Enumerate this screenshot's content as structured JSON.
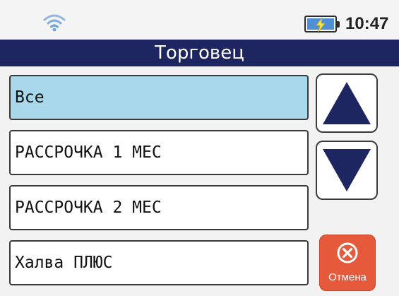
{
  "status": {
    "time": "10:47",
    "wifi_icon": "wifi-icon",
    "battery_icon": "battery-charging-icon"
  },
  "header": {
    "title": "Торговец"
  },
  "list": {
    "items": [
      {
        "label": "Все",
        "selected": true
      },
      {
        "label": "РАССРОЧКА 1 МЕС",
        "selected": false
      },
      {
        "label": "РАССРОЧКА 2 МЕС",
        "selected": false
      },
      {
        "label": "Халва ПЛЮС",
        "selected": false
      }
    ]
  },
  "controls": {
    "scroll_up_icon": "triangle-up-icon",
    "scroll_down_icon": "triangle-down-icon",
    "cancel_label": "Отмена",
    "cancel_icon": "close-circle-icon"
  },
  "colors": {
    "title_bar": "#1d2660",
    "selected_item": "#a8d8ea",
    "arrow": "#1d2660",
    "cancel": "#e55a3a"
  }
}
